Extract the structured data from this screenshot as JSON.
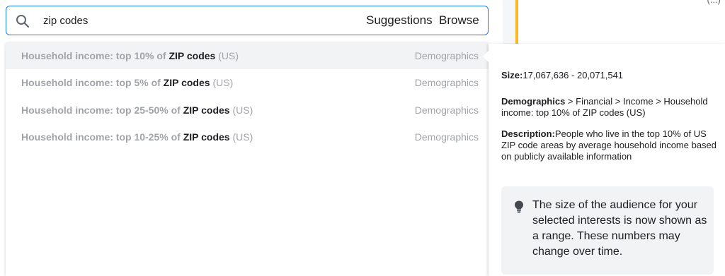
{
  "search": {
    "value": "zip codes",
    "tabs": {
      "suggestions": "Suggestions",
      "browse": "Browse"
    }
  },
  "suggestions": [
    {
      "prefix": "Household income: top 10% of ",
      "match": "ZIP codes",
      "suffix": " (US)",
      "category": "Demographics",
      "active": true
    },
    {
      "prefix": "Household income: top 5% of ",
      "match": "ZIP codes",
      "suffix": " (US)",
      "category": "Demographics",
      "active": false
    },
    {
      "prefix": "Household income: top 25-50% of ",
      "match": "ZIP codes",
      "suffix": " (US)",
      "category": "Demographics",
      "active": false
    },
    {
      "prefix": "Household income: top 10-25% of ",
      "match": "ZIP codes",
      "suffix": " (US)",
      "category": "Demographics",
      "active": false
    }
  ],
  "detail": {
    "size_label": "Size:",
    "size_value": "17,067,636 - 20,071,541",
    "path_root": "Demographics",
    "path_rest": " > Financial > Income > Household income: top 10% of ZIP codes (US)",
    "description_label": "Description:",
    "description_value": "People who live in the top 10% of US ZIP code areas by average household income based on publicly available information",
    "tip_icon": "lightbulb-icon",
    "tip_text": "The size of the audience for your selected interests is now shown as a range. These numbers may change over time."
  },
  "background": {
    "card_text": "(...)"
  },
  "colors": {
    "accent": "#1877f2",
    "highlight_bar": "#f7b928"
  }
}
